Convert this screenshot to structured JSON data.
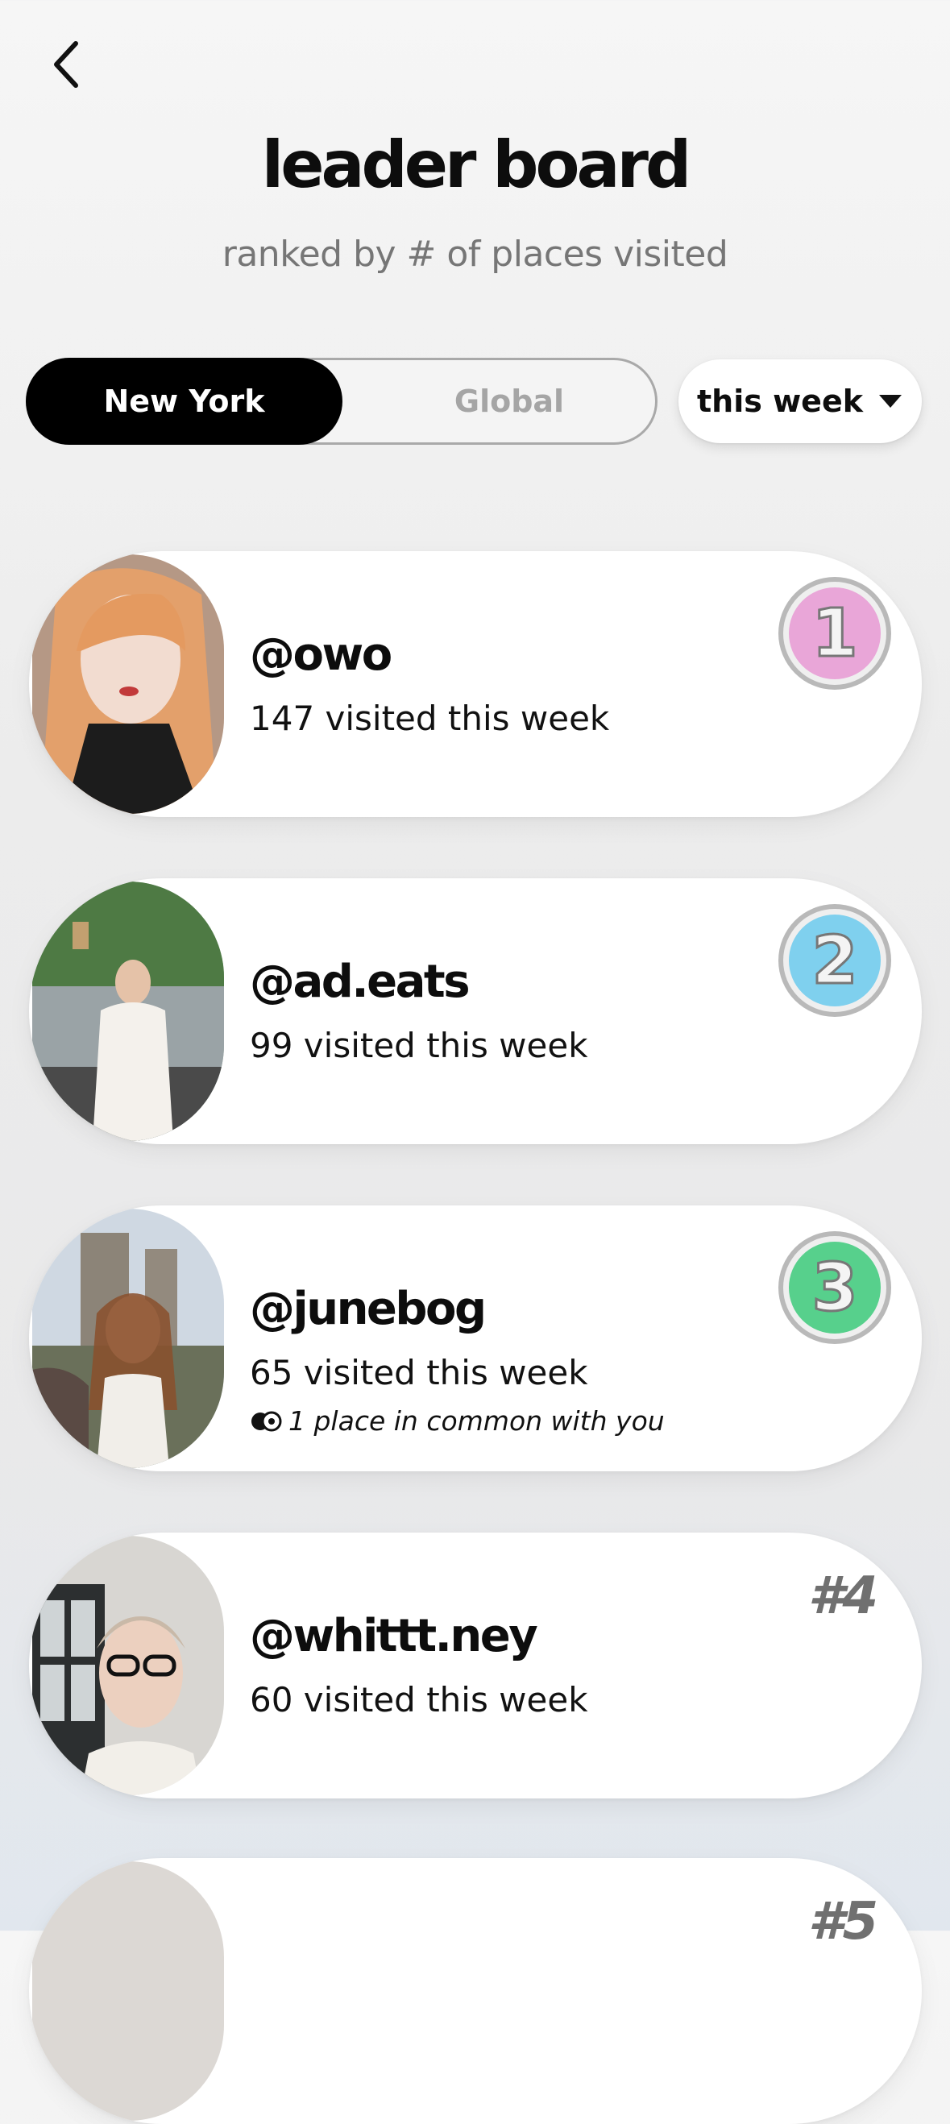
{
  "header": {
    "title": "leader board",
    "subtitle": "ranked by # of places visited"
  },
  "scope_toggle": {
    "options": [
      "New York",
      "Global"
    ],
    "selected": "New York"
  },
  "period_dropdown": {
    "label": "this week"
  },
  "leaderboard": [
    {
      "rank": 1,
      "handle": "@owo",
      "visits": "147 visited this week",
      "badge": "medal-1",
      "badge_color": "#e9a6d8"
    },
    {
      "rank": 2,
      "handle": "@ad.eats",
      "visits": "99 visited this week",
      "badge": "medal-2",
      "badge_color": "#7fd0ee"
    },
    {
      "rank": 3,
      "handle": "@junebog",
      "visits": "65 visited this week",
      "common": "1 place in common with you",
      "badge": "medal-3",
      "badge_color": "#57d08c"
    },
    {
      "rank": 4,
      "handle": "@whittt.ney",
      "visits": "60 visited this week",
      "rank_label": "#4"
    },
    {
      "rank": 5,
      "rank_label": "#5"
    }
  ],
  "colors": {
    "accent_active": "#000000",
    "inactive_text": "#a5a5a5",
    "rank_text": "#707070"
  }
}
